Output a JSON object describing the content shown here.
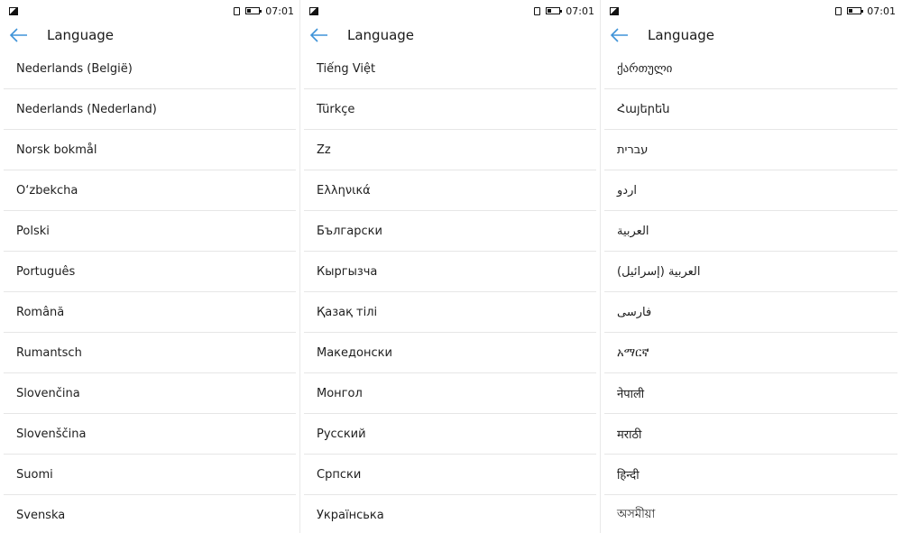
{
  "status": {
    "time": "07:01"
  },
  "screens": [
    {
      "title": "Language",
      "items": [
        {
          "label": "Nederlands (België)",
          "rtl": false
        },
        {
          "label": "Nederlands (Nederland)",
          "rtl": false
        },
        {
          "label": "Norsk bokmål",
          "rtl": false
        },
        {
          "label": "O‘zbekcha",
          "rtl": false
        },
        {
          "label": "Polski",
          "rtl": false
        },
        {
          "label": "Português",
          "rtl": false
        },
        {
          "label": "Română",
          "rtl": false
        },
        {
          "label": "Rumantsch",
          "rtl": false
        },
        {
          "label": "Slovenčina",
          "rtl": false
        },
        {
          "label": "Slovenščina",
          "rtl": false
        },
        {
          "label": "Suomi",
          "rtl": false
        },
        {
          "label": "Svenska",
          "rtl": false
        }
      ]
    },
    {
      "title": "Language",
      "items": [
        {
          "label": "Tiếng Việt",
          "rtl": false
        },
        {
          "label": "Türkçe",
          "rtl": false
        },
        {
          "label": "Zz",
          "rtl": false
        },
        {
          "label": "Ελληνικά",
          "rtl": false
        },
        {
          "label": "Български",
          "rtl": false
        },
        {
          "label": "Кыргызча",
          "rtl": false
        },
        {
          "label": "Қазақ тілі",
          "rtl": false
        },
        {
          "label": "Македонски",
          "rtl": false
        },
        {
          "label": "Монгол",
          "rtl": false
        },
        {
          "label": "Русский",
          "rtl": false
        },
        {
          "label": "Српски",
          "rtl": false
        },
        {
          "label": "Українська",
          "rtl": false
        }
      ]
    },
    {
      "title": "Language",
      "items": [
        {
          "label": "ქართული",
          "rtl": false
        },
        {
          "label": "Հայերեն",
          "rtl": false
        },
        {
          "label": "עברית",
          "rtl": true
        },
        {
          "label": "اردو",
          "rtl": true
        },
        {
          "label": "العربية",
          "rtl": true
        },
        {
          "label": "العربية (إسرائيل)",
          "rtl": true
        },
        {
          "label": "فارسی",
          "rtl": true
        },
        {
          "label": "አማርኛ",
          "rtl": false
        },
        {
          "label": "नेपाली",
          "rtl": false
        },
        {
          "label": "मराठी",
          "rtl": false
        },
        {
          "label": "हिन्दी",
          "rtl": false
        },
        {
          "label": "অসমীয়া",
          "rtl": false
        }
      ]
    }
  ]
}
